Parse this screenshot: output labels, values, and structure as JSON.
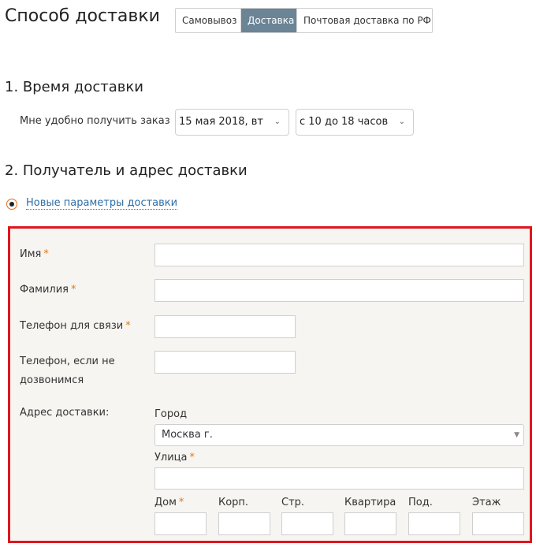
{
  "header": {
    "title": "Способ доставки",
    "tabs": [
      {
        "label": "Самовывоз",
        "active": false
      },
      {
        "label": "Доставка",
        "active": true
      },
      {
        "label": "Почтовая доставка по РФ",
        "active": false
      }
    ]
  },
  "time_section": {
    "title": "1. Время доставки",
    "label": "Мне удобно получить заказ",
    "date_value": "15 мая 2018, вт",
    "time_value": "с 10 до 18 часов"
  },
  "recipient_section": {
    "title": "2. Получатель и адрес доставки",
    "radio_label": "Новые параметры доставки"
  },
  "form": {
    "first_name": {
      "label": "Имя",
      "required_mark": "*",
      "value": ""
    },
    "last_name": {
      "label": "Фамилия",
      "required_mark": "*",
      "value": ""
    },
    "phone": {
      "label": "Телефон для связи",
      "required_mark": "*",
      "value": ""
    },
    "phone_alt": {
      "label_line1": "Телефон, если не",
      "label_line2": "дозвонимся",
      "value": ""
    },
    "address": {
      "label": "Адрес доставки:",
      "city_label": "Город",
      "city_value": "Москва г.",
      "street_label": "Улица",
      "street_required": "*",
      "house_label": "Дом",
      "house_required": "*",
      "building_label": "Корп.",
      "structure_label": "Стр.",
      "apartment_label": "Квартира",
      "entrance_label": "Под.",
      "floor_label": "Этаж"
    }
  },
  "colors": {
    "active_tab": "#6b8496",
    "panel_border": "#e0161d",
    "panel_background": "#f6f5f2",
    "required_mark": "#e07b12",
    "link": "#2c6ea6"
  },
  "icons": {
    "dropdown": "chevron-down-icon",
    "city_dropdown": "caret-down-icon",
    "radio": "radio-selected-icon"
  }
}
